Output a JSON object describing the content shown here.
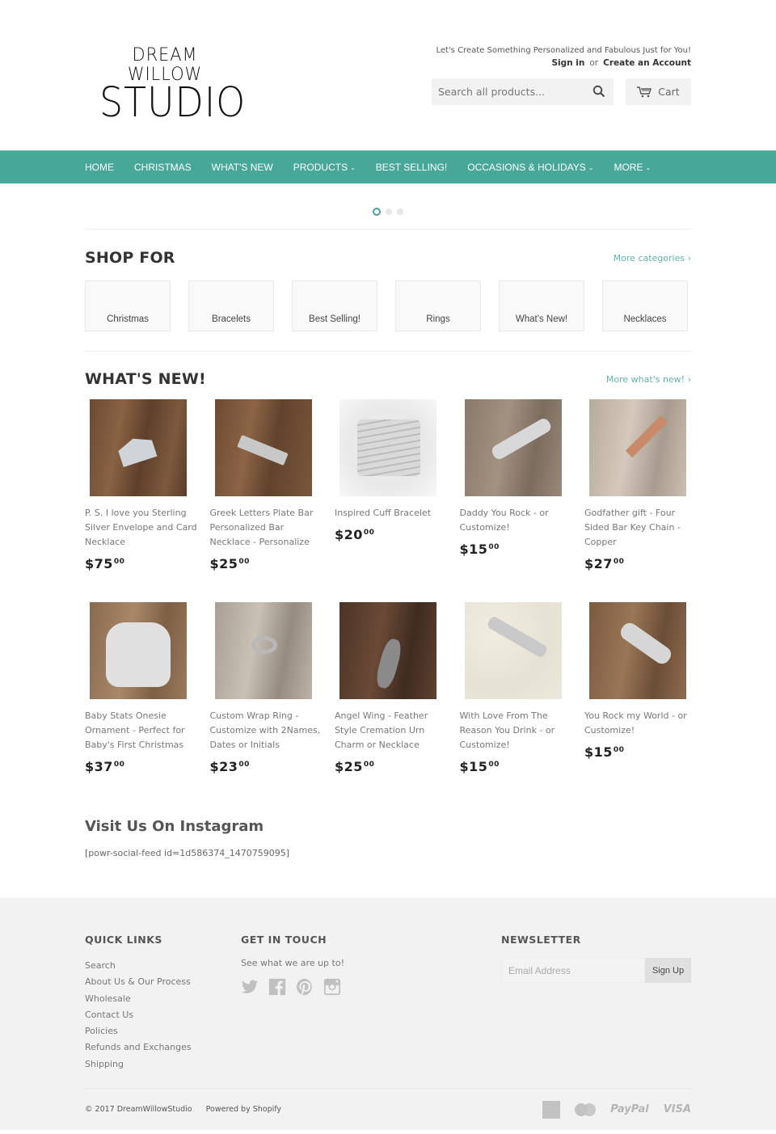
{
  "header": {
    "logo_line1": "DREAM WILLOW",
    "logo_line2": "STUDIO",
    "tagline": "Let's Create Something Personalized and Fabulous Just for You!",
    "sign_in": "Sign in",
    "or": "or",
    "create_account": "Create an Account",
    "search_placeholder": "Search all products...",
    "search_icon": "search-icon",
    "cart_label": "Cart",
    "cart_icon": "cart-icon"
  },
  "nav": {
    "accent": "#47a89a",
    "items": [
      {
        "label": "HOME",
        "dropdown": false
      },
      {
        "label": "CHRISTMAS",
        "dropdown": false
      },
      {
        "label": "WHAT'S NEW",
        "dropdown": false
      },
      {
        "label": "PRODUCTS",
        "dropdown": true
      },
      {
        "label": "BEST SELLING!",
        "dropdown": false
      },
      {
        "label": "OCCASIONS & HOLIDAYS",
        "dropdown": true
      },
      {
        "label": "MORE",
        "dropdown": true
      }
    ]
  },
  "slider": {
    "slides": 3,
    "active": 1
  },
  "shop_for": {
    "title": "SHOP FOR",
    "more_link": "More categories ›",
    "categories": [
      "Christmas",
      "Bracelets",
      "Best Selling!",
      "Rings",
      "What's New!",
      "Necklaces"
    ]
  },
  "whats_new": {
    "title": "WHAT'S NEW!",
    "more_link": "More what's new! ›",
    "products": [
      {
        "name": "P. S. I love you Sterling Silver Envelope and Card Necklace",
        "price_main": "$75",
        "price_cents": "00"
      },
      {
        "name": "Greek Letters Plate Bar Personalized Bar Necklace - Personalize",
        "price_main": "$25",
        "price_cents": "00"
      },
      {
        "name": "Inspired Cuff Bracelet",
        "price_main": "$20",
        "price_cents": "00"
      },
      {
        "name": "Daddy You Rock - or Customize!",
        "price_main": "$15",
        "price_cents": "00"
      },
      {
        "name": "Godfather gift - Four Sided Bar Key Chain - Copper",
        "price_main": "$27",
        "price_cents": "00"
      },
      {
        "name": "Baby Stats Onesie Ornament - Perfect for Baby's First Christmas",
        "price_main": "$37",
        "price_cents": "00"
      },
      {
        "name": "Custom Wrap Ring - Customize with 2Names, Dates or Initials",
        "price_main": "$23",
        "price_cents": "00"
      },
      {
        "name": "Angel Wing - Feather Style Cremation Urn Charm or Necklace",
        "price_main": "$25",
        "price_cents": "00"
      },
      {
        "name": "With Love From The Reason You Drink - or Customize!",
        "price_main": "$15",
        "price_cents": "00"
      },
      {
        "name": "You Rock my World - or Customize!",
        "price_main": "$15",
        "price_cents": "00"
      }
    ]
  },
  "instagram": {
    "title": "Visit Us On Instagram",
    "shortcode": "[powr-social-feed id=1d586374_1470759095]"
  },
  "footer": {
    "quick_links": {
      "title": "QUICK LINKS",
      "items": [
        "Search",
        "About Us & Our Process",
        "Wholesale",
        "Contact Us",
        "Policies",
        "Refunds and Exchanges",
        "Shipping"
      ]
    },
    "get_in_touch": {
      "title": "GET IN TOUCH",
      "text": "See what we are up to!",
      "social": [
        "twitter-icon",
        "facebook-icon",
        "pinterest-icon",
        "instagram-icon"
      ]
    },
    "newsletter": {
      "title": "NEWSLETTER",
      "placeholder": "Email Address",
      "button": "Sign Up"
    },
    "copyright": "© 2017 DreamWillowStudio",
    "powered": "Powered by Shopify",
    "payments": [
      "American Express",
      "Master",
      "PayPal",
      "VISA"
    ]
  }
}
